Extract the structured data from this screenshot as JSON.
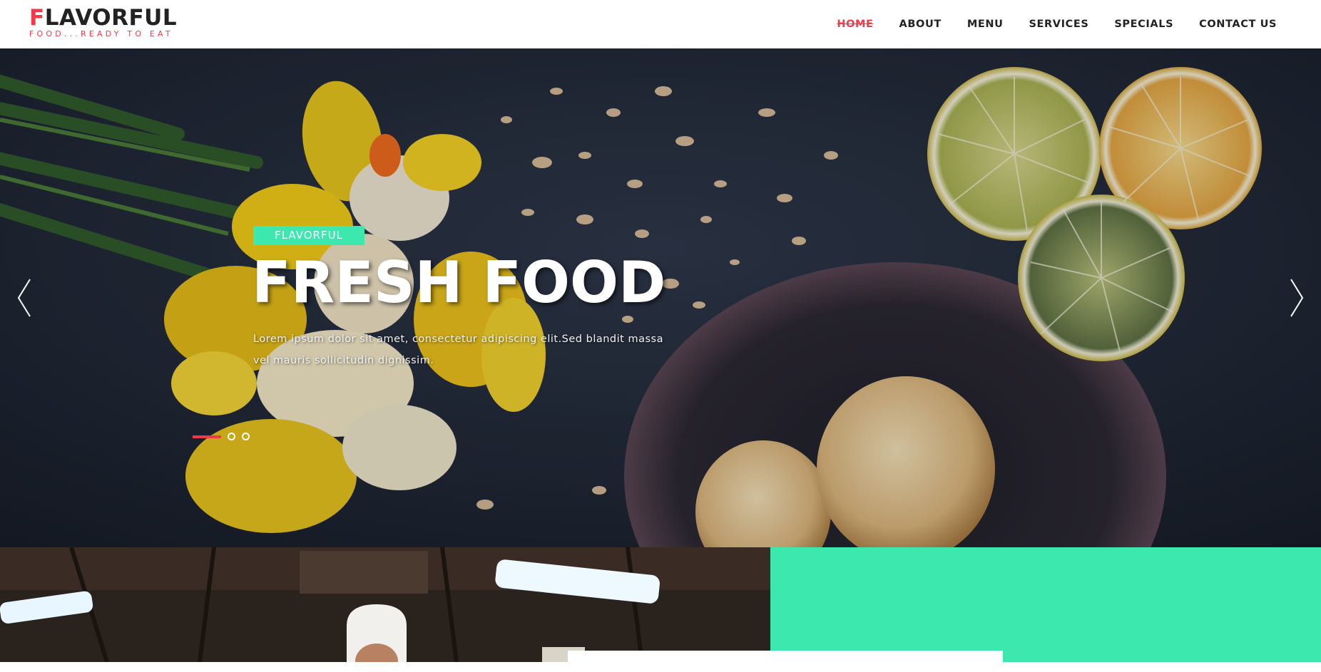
{
  "brand": {
    "first_letter": "F",
    "rest": "LAVORFUL",
    "tagline": "FOOD...READY TO EAT"
  },
  "nav": {
    "items": [
      {
        "label": "HOME",
        "active": true
      },
      {
        "label": "ABOUT"
      },
      {
        "label": "MENU"
      },
      {
        "label": "SERVICES"
      },
      {
        "label": "SPECIALS"
      },
      {
        "label": "CONTACT US"
      }
    ]
  },
  "hero": {
    "tag": "FLAVORFUL",
    "title": "FRESH FOOD",
    "text": "Lorem ipsum dolor sit amet, consectetur adipiscing elit.Sed blandit massa vel mauris sollicitudin dignissim.",
    "slides": 3,
    "active_slide": 1,
    "prev_icon": "chevron-left-icon",
    "next_icon": "chevron-right-icon"
  },
  "colors": {
    "accent": "#f03a4b",
    "mint": "#3de8ae"
  }
}
